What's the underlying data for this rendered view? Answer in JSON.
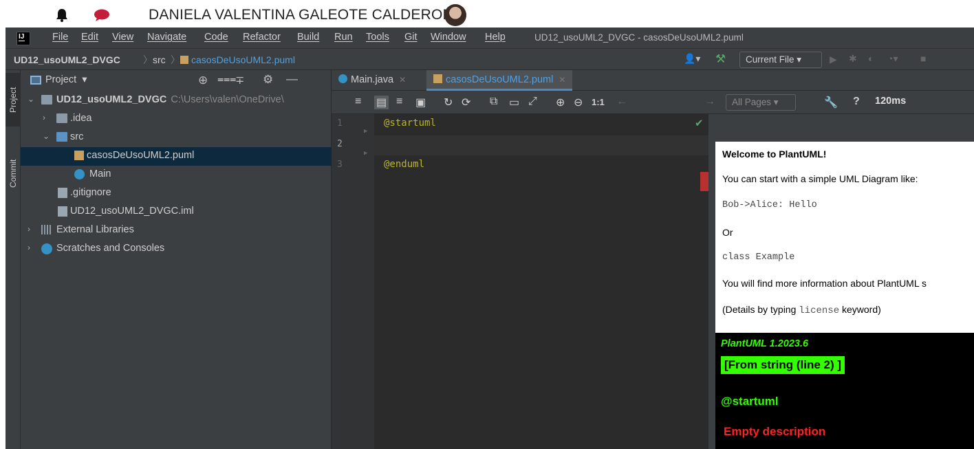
{
  "taskbar": {
    "username": "DANIELA VALENTINA GALEOTE CALDERON"
  },
  "menubar": {
    "items": [
      "File",
      "Edit",
      "View",
      "Navigate",
      "Code",
      "Refactor",
      "Build",
      "Run",
      "Tools",
      "Git",
      "Window",
      "Help"
    ],
    "window_title": "UD12_usoUML2_DVGC - casosDeUsoUML2.puml"
  },
  "breadcrumb": {
    "project": "UD12_usoUML2_DVGC",
    "folder": "src",
    "file": "casosDeUsoUML2.puml"
  },
  "run_config": "Current File",
  "side_tabs": [
    "Project",
    "Commit"
  ],
  "project_panel": {
    "title": "Project",
    "tree": {
      "root_name": "UD12_usoUML2_DVGC",
      "root_path": "C:\\Users\\valen\\OneDrive\\",
      "idea": ".idea",
      "src": "src",
      "puml": "casosDeUsoUML2.puml",
      "main": "Main",
      "gitignore": ".gitignore",
      "iml": "UD12_usoUML2_DVGC.iml",
      "ext_libs": "External Libraries",
      "scratches": "Scratches and Consoles"
    }
  },
  "editor_tabs": [
    "Main.java",
    "casosDeUsoUML2.puml"
  ],
  "preview_toolbar": {
    "zoom_reset": "1:1",
    "pages": "All Pages",
    "help": "?",
    "timing": "120ms"
  },
  "code": {
    "line_numbers": [
      "1",
      "2",
      "3"
    ],
    "lines": [
      "@startuml",
      "",
      "@enduml"
    ]
  },
  "preview": {
    "welcome": "Welcome to PlantUML!",
    "intro": "You can start with a simple UML Diagram like:",
    "example1": "Bob->Alice: Hello",
    "or": "Or",
    "example2": "class Example",
    "more_info": "You will find more information about PlantUML s",
    "details_prefix": "(Details by typing",
    "details_kw": "license",
    "details_suffix": "keyword)",
    "version": "PlantUML 1.2023.6",
    "from_string": "[From string (line 2) ]",
    "startuml": "@startuml",
    "error": "Empty description"
  }
}
